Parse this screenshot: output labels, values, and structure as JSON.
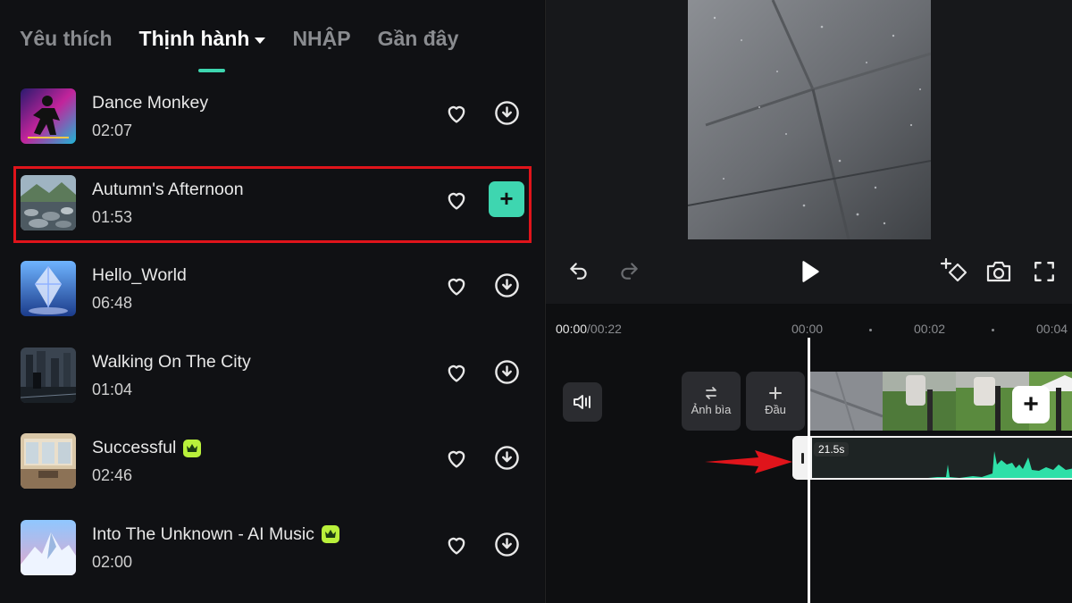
{
  "tabs": [
    {
      "label": "Yêu thích"
    },
    {
      "label": "Thịnh hành"
    },
    {
      "label": "NHẬP"
    },
    {
      "label": "Gần đây"
    }
  ],
  "songs": [
    {
      "title": "Dance Monkey",
      "duration": "02:07",
      "premium": false,
      "action": "download"
    },
    {
      "title": "Autumn's Afternoon",
      "duration": "01:53",
      "premium": false,
      "action": "add"
    },
    {
      "title": "Hello_World",
      "duration": "06:48",
      "premium": false,
      "action": "download"
    },
    {
      "title": "Walking On The City",
      "duration": "01:04",
      "premium": false,
      "action": "download"
    },
    {
      "title": "Successful",
      "duration": "02:46",
      "premium": true,
      "action": "download"
    },
    {
      "title": "Into The Unknown - AI Music",
      "duration": "02:00",
      "premium": true,
      "action": "download"
    }
  ],
  "add_button_label": "+",
  "timeline": {
    "current": "00:00",
    "total": "/00:22",
    "ticks": [
      "00:00",
      "00:02",
      "00:04"
    ],
    "cover_label": "Ảnh bìa",
    "start_label": "Đầu",
    "audio_length": "21.5s",
    "clip_add_label": "+"
  },
  "colors": {
    "accent": "#3ed6b0",
    "highlight": "#e0141b",
    "premium": "#b9f03b",
    "waveform": "#2fe0a8"
  }
}
